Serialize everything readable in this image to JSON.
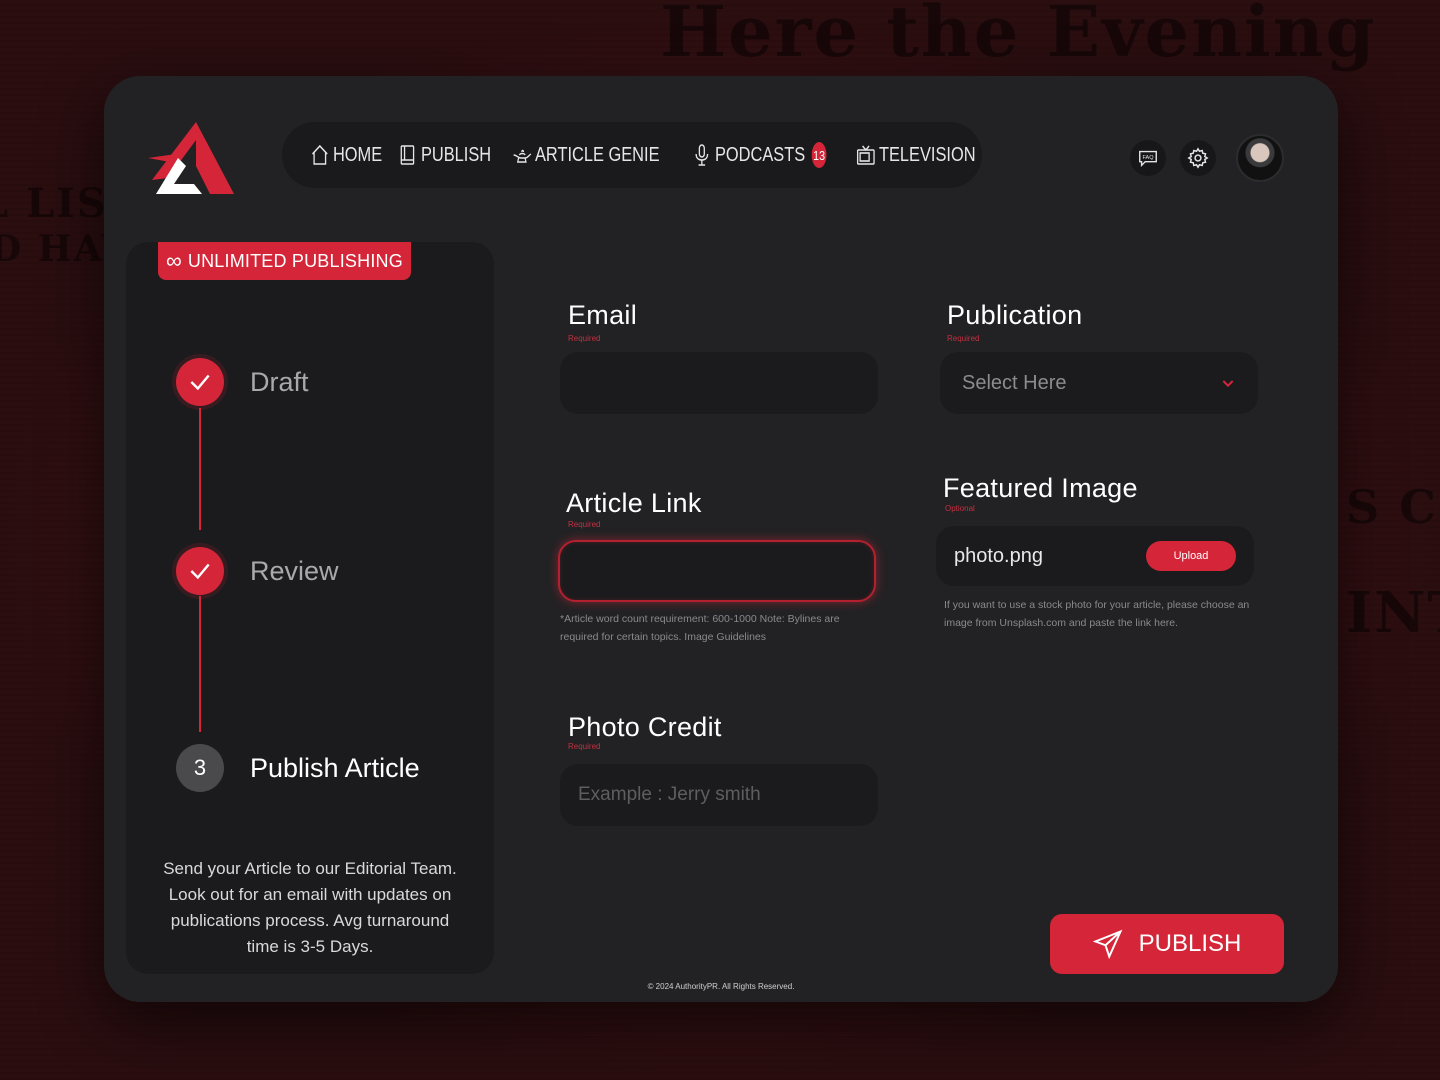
{
  "brand": {
    "accent": "#d42638",
    "card_bg": "#222224",
    "panel_bg": "#1b1b1d"
  },
  "nav": {
    "items": [
      {
        "label": "HOME",
        "icon": "home-icon"
      },
      {
        "label": "PUBLISH",
        "icon": "book-icon"
      },
      {
        "label": "ARTICLE GENIE",
        "icon": "genie-lamp-icon"
      },
      {
        "label": "PODCASTS",
        "icon": "microphone-icon",
        "badge": "13"
      },
      {
        "label": "TELEVISION",
        "icon": "tv-icon"
      }
    ]
  },
  "top_icons": {
    "faq": "FAQ"
  },
  "sidebar": {
    "badge": "UNLIMITED PUBLISHING",
    "badge_symbol": "∞",
    "steps": [
      {
        "label": "Draft",
        "status": "done"
      },
      {
        "label": "Review",
        "status": "done"
      },
      {
        "label": "Publish Article",
        "status": "current",
        "number": "3"
      }
    ],
    "note": "Send your Article to our Editorial Team. Look out for an email with updates on publications process. Avg turnaround time is 3-5 Days."
  },
  "form": {
    "email": {
      "label": "Email",
      "hint": "Required",
      "value": ""
    },
    "publication": {
      "label": "Publication",
      "hint": "Required",
      "placeholder": "Select Here"
    },
    "article_link": {
      "label": "Article Link",
      "hint": "Required",
      "value": "",
      "note": "*Article word count requirement: 600-1000 Note: Bylines are required for certain topics. Image Guidelines"
    },
    "featured_image": {
      "label": "Featured Image",
      "hint": "Optional",
      "file": "photo.png",
      "button": "Upload",
      "note": "If you want to use a stock photo for your article, please choose an image from Unsplash.com and paste the link here."
    },
    "photo_credit": {
      "label": "Photo Credit",
      "hint": "Required",
      "placeholder": "Example : Jerry smith"
    }
  },
  "publish_button": "PUBLISH",
  "footer": "© 2024 AuthorityPR. All Rights Reserved."
}
